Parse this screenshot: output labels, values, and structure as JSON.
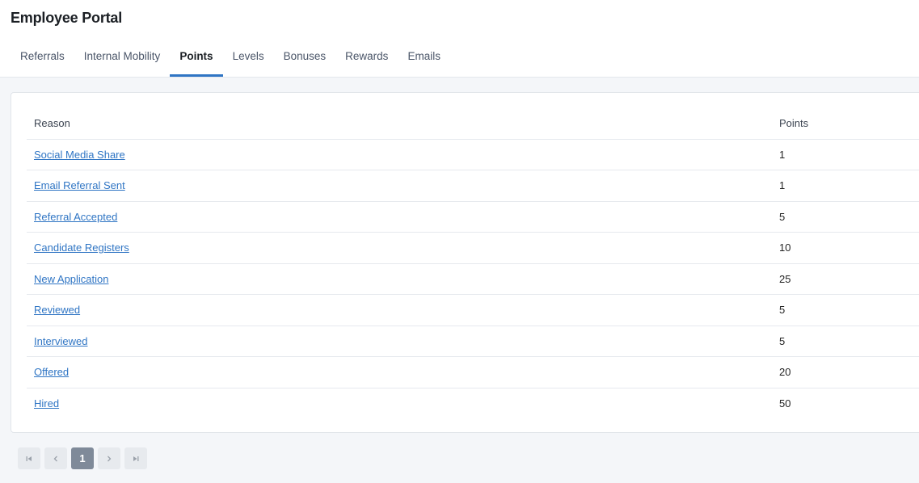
{
  "header": {
    "title": "Employee Portal",
    "tabs": [
      {
        "label": "Referrals"
      },
      {
        "label": "Internal Mobility"
      },
      {
        "label": "Points",
        "active": true
      },
      {
        "label": "Levels"
      },
      {
        "label": "Bonuses"
      },
      {
        "label": "Rewards"
      },
      {
        "label": "Emails"
      }
    ]
  },
  "table": {
    "columns": {
      "reason": "Reason",
      "points": "Points"
    },
    "rows": [
      {
        "reason": "Social Media Share",
        "points": "1"
      },
      {
        "reason": "Email Referral Sent",
        "points": "1"
      },
      {
        "reason": "Referral Accepted",
        "points": "5"
      },
      {
        "reason": "Candidate Registers",
        "points": "10"
      },
      {
        "reason": "New Application",
        "points": "25"
      },
      {
        "reason": "Reviewed",
        "points": "5"
      },
      {
        "reason": "Interviewed",
        "points": "5"
      },
      {
        "reason": "Offered",
        "points": "20"
      },
      {
        "reason": "Hired",
        "points": "50"
      }
    ]
  },
  "pagination": {
    "current_page": "1",
    "icons": [
      "first-page-icon",
      "prev-page-icon",
      "next-page-icon",
      "last-page-icon"
    ]
  },
  "colors": {
    "accent": "#2f75c4",
    "page_active": "#7f8a99"
  }
}
